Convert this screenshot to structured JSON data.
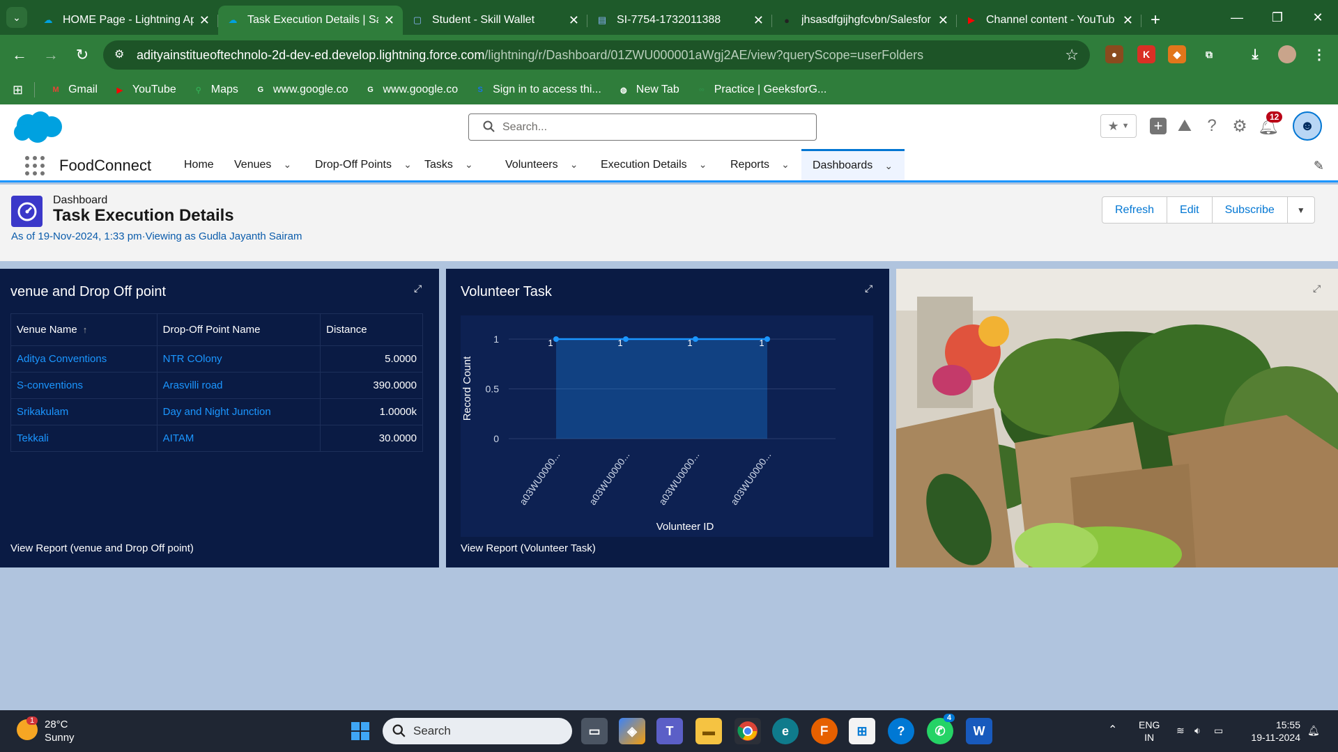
{
  "browser": {
    "tabs": [
      {
        "title": "HOME Page - Lightning Ap",
        "icon": "salesforce-cloud-icon",
        "active": false
      },
      {
        "title": "Task Execution Details | Sal",
        "icon": "salesforce-cloud-icon",
        "active": true
      },
      {
        "title": "Student - Skill Wallet",
        "icon": "skillwallet-icon",
        "active": false
      },
      {
        "title": "SI-7754-1732011388",
        "icon": "document-icon",
        "active": false
      },
      {
        "title": "jhsasdfgijhgfcvbn/Salesfor",
        "icon": "github-icon",
        "active": false
      },
      {
        "title": "Channel content - YouTub",
        "icon": "youtube-icon",
        "active": false
      }
    ],
    "url_host": "adityainstitueoftechnolo-2d-dev-ed.develop.lightning.force.com",
    "url_path": "/lightning/r/Dashboard/01ZWU000001aWgj2AE/view?queryScope=userFolders",
    "bookmarks": [
      {
        "label": "Gmail",
        "icon": "gmail-icon",
        "color": "#ea4335"
      },
      {
        "label": "YouTube",
        "icon": "youtube-icon",
        "color": "#ff0000"
      },
      {
        "label": "Maps",
        "icon": "maps-icon",
        "color": "#34a853"
      },
      {
        "label": "www.google.co",
        "icon": "google-icon",
        "color": "#ffffff"
      },
      {
        "label": "www.google.co",
        "icon": "google-icon",
        "color": "#ffffff"
      },
      {
        "label": "Sign in to access thi...",
        "icon": "s-icon",
        "color": "#1a73e8"
      },
      {
        "label": "New Tab",
        "icon": "globe-icon",
        "color": "#ffffff"
      },
      {
        "label": "Practice | GeeksforG...",
        "icon": "gfg-icon",
        "color": "#2f8d46"
      }
    ]
  },
  "sf": {
    "search_placeholder": "Search...",
    "notification_count": "12",
    "app_name": "FoodConnect",
    "nav": [
      {
        "label": "Home",
        "has_menu": false,
        "active": false
      },
      {
        "label": "Venues",
        "has_menu": true,
        "active": false
      },
      {
        "label": "Drop-Off Points",
        "has_menu": true,
        "active": false
      },
      {
        "label": "Tasks",
        "has_menu": true,
        "active": false
      },
      {
        "label": "Volunteers",
        "has_menu": true,
        "active": false
      },
      {
        "label": "Execution Details",
        "has_menu": true,
        "active": false
      },
      {
        "label": "Reports",
        "has_menu": true,
        "active": false
      },
      {
        "label": "Dashboards",
        "has_menu": true,
        "active": true
      }
    ]
  },
  "dashboard": {
    "type_label": "Dashboard",
    "title": "Task Execution Details",
    "as_of": "As of 19-Nov-2024, 1:33 pm·Viewing as Gudla Jayanth Sairam",
    "buttons": {
      "refresh": "Refresh",
      "edit": "Edit",
      "subscribe": "Subscribe"
    }
  },
  "table_widget": {
    "title": "venue and Drop Off point",
    "columns": [
      "Venue Name",
      "Drop-Off Point Name",
      "Distance"
    ],
    "sort_indicator": "↑",
    "rows": [
      [
        "Aditya Conventions",
        "NTR COlony",
        "5.0000"
      ],
      [
        "S-conventions",
        "Arasvilli road",
        "390.0000"
      ],
      [
        "Srikakulam",
        "Day and Night Junction",
        "1.0000k"
      ],
      [
        "Tekkali",
        "AITAM",
        "30.0000"
      ]
    ],
    "footer": "View Report (venue and Drop Off point)"
  },
  "chart_widget": {
    "title": "Volunteer Task",
    "footer": "View Report (Volunteer Task)"
  },
  "chart_data": {
    "type": "area",
    "categories": [
      "a03WU0000...",
      "a03WU0000...",
      "a03WU0000...",
      "a03WU0000..."
    ],
    "values": [
      1,
      1,
      1,
      1
    ],
    "data_labels": [
      "1",
      "1",
      "1",
      "1"
    ],
    "xlabel": "Volunteer ID",
    "ylabel": "Record Count",
    "yticks": [
      "0",
      "0.5",
      "1"
    ],
    "ylim": [
      0,
      1
    ],
    "grid": true,
    "color": "#1b96ff"
  },
  "taskbar": {
    "weather_temp": "28°C",
    "weather_desc": "Sunny",
    "weather_badge": "1",
    "search_placeholder": "Search",
    "whatsapp_badge": "4",
    "lang_top": "ENG",
    "lang_bottom": "IN",
    "time": "15:55",
    "date": "19-11-2024"
  }
}
